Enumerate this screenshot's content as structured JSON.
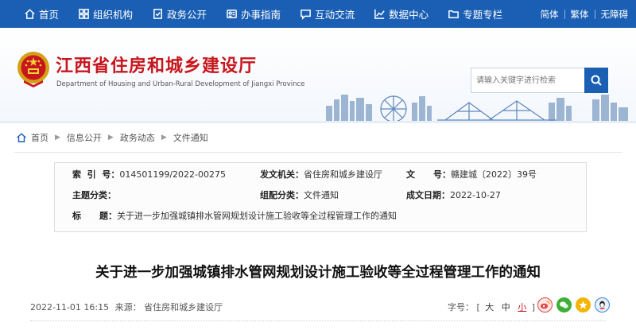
{
  "nav": {
    "items": [
      {
        "label": "首页",
        "icon": "home-icon"
      },
      {
        "label": "组织机构",
        "icon": "grid-icon"
      },
      {
        "label": "政务公开",
        "icon": "document-check-icon"
      },
      {
        "label": "办事指南",
        "icon": "id-card-icon"
      },
      {
        "label": "互动交流",
        "icon": "chat-icon"
      },
      {
        "label": "数据中心",
        "icon": "chart-line-icon"
      },
      {
        "label": "专题专栏",
        "icon": "folder-icon"
      }
    ],
    "lang": {
      "simplified": "简体",
      "traditional": "繁体",
      "accessible": "无障碍"
    }
  },
  "header": {
    "title": "江西省住房和城乡建设厅",
    "subtitle": "Department of Housing and Urban-Rural Development of Jiangxi Province",
    "search_placeholder": "请输入关键字进行检索",
    "emblem_icon": "national-emblem-icon",
    "brand_color": "#c8161d",
    "accent_color": "#1a5fb4"
  },
  "breadcrumb": [
    "首页",
    "信息公开",
    "政务动态",
    "文件通知"
  ],
  "meta": {
    "index_label": "索  引  号：",
    "index_value": "014501199/2022-00275",
    "issuer_label": "发文机关：",
    "issuer_value": "省住房和城乡建设厅",
    "docno_label": "文      号：",
    "docno_value": "赣建城〔2022〕39号",
    "topic_label": "主题分类：",
    "topic_value": "",
    "category_label": "组配分类：",
    "category_value": "文件通知",
    "date_label": "成文日期：",
    "date_value": "2022-10-27",
    "title_label": "标      题：",
    "title_value": "关于进一步加强城镇排水管网规划设计施工验收等全过程管理工作的通知"
  },
  "article": {
    "title": "关于进一步加强城镇排水管网规划设计施工验收等全过程管理工作的通知",
    "datetime": "2022-11-01 16:15",
    "source_label": "来源：",
    "source_value": "省住房和城乡建设厅",
    "font_size_label": "字号：",
    "font_open": "[",
    "font_large": "大",
    "font_medium": "中",
    "font_small": "小",
    "font_close": "]",
    "share_icons": [
      "weibo-icon",
      "wechat-icon",
      "qzone-icon",
      "qq-icon"
    ]
  }
}
